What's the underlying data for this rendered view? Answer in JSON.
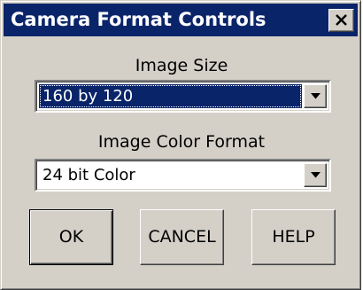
{
  "window": {
    "title": "Camera Format Controls"
  },
  "icons": {
    "close": "close-icon",
    "dropdown": "chevron-down-icon"
  },
  "image_size": {
    "label": "Image Size",
    "value": "160 by 120"
  },
  "color_format": {
    "label": "Image Color Format",
    "value": "24 bit Color"
  },
  "buttons": {
    "ok": "OK",
    "cancel": "CANCEL",
    "help": "HELP"
  },
  "colors": {
    "titlebar": "#0a246a",
    "face": "#d4d0c8",
    "selection": "#0a246a"
  }
}
